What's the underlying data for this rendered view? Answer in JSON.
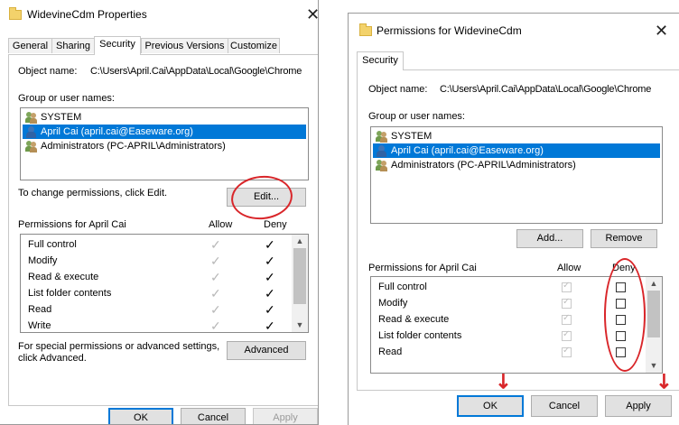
{
  "dialog1": {
    "title": "WidevineCdm Properties",
    "tabs": [
      "General",
      "Sharing",
      "Security",
      "Previous Versions",
      "Customize"
    ],
    "active_tab": "Security",
    "object_name_label": "Object name:",
    "object_name_value": "C:\\Users\\April.Cai\\AppData\\Local\\Google\\Chrome",
    "groups_label": "Group or user names:",
    "users": [
      {
        "name": "SYSTEM",
        "icon": "group-users-icon",
        "selected": false
      },
      {
        "name": "April Cai (april.cai@Easeware.org)",
        "icon": "single-user-icon",
        "selected": true
      },
      {
        "name": "Administrators (PC-APRIL\\Administrators)",
        "icon": "group-users-icon",
        "selected": false
      }
    ],
    "change_text": "To change permissions, click Edit.",
    "edit_button": "Edit...",
    "permissions_label": "Permissions for April Cai",
    "allow_header": "Allow",
    "deny_header": "Deny",
    "permissions": [
      "Full control",
      "Modify",
      "Read & execute",
      "List folder contents",
      "Read",
      "Write"
    ],
    "special_text_1": "For special permissions or advanced settings,",
    "special_text_2": "click Advanced.",
    "advanced_button": "Advanced",
    "ok_button": "OK",
    "cancel_button": "Cancel",
    "apply_button": "Apply"
  },
  "dialog2": {
    "title": "Permissions for WidevineCdm",
    "tab": "Security",
    "object_name_label": "Object name:",
    "object_name_value": "C:\\Users\\April.Cai\\AppData\\Local\\Google\\Chrome",
    "groups_label": "Group or user names:",
    "users": [
      {
        "name": "SYSTEM",
        "icon": "group-users-icon",
        "selected": false
      },
      {
        "name": "April Cai (april.cai@Easeware.org)",
        "icon": "single-user-icon",
        "selected": true
      },
      {
        "name": "Administrators (PC-APRIL\\Administrators)",
        "icon": "group-users-icon",
        "selected": false
      }
    ],
    "add_button": "Add...",
    "remove_button": "Remove",
    "permissions_label": "Permissions for April Cai",
    "allow_header": "Allow",
    "deny_header": "Deny",
    "permissions": [
      "Full control",
      "Modify",
      "Read & execute",
      "List folder contents",
      "Read"
    ],
    "ok_button": "OK",
    "cancel_button": "Cancel",
    "apply_button": "Apply"
  },
  "colors": {
    "selection": "#0078d7",
    "annotation": "#d9262a"
  }
}
